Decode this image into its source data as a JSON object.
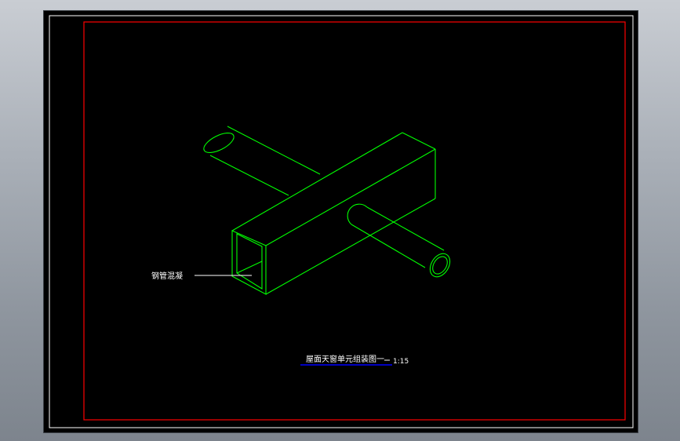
{
  "drawing": {
    "callout_label": "钢管混凝",
    "title": "屋面天窗单元组装图一",
    "scale": "1:15",
    "colors": {
      "background": "#000000",
      "outer_frame": "#ffffff",
      "inner_border": "#ff0000",
      "geometry": "#00ff00",
      "leader": "#ffffff",
      "text": "#ffffff",
      "title_underline": "#0000ff"
    }
  }
}
